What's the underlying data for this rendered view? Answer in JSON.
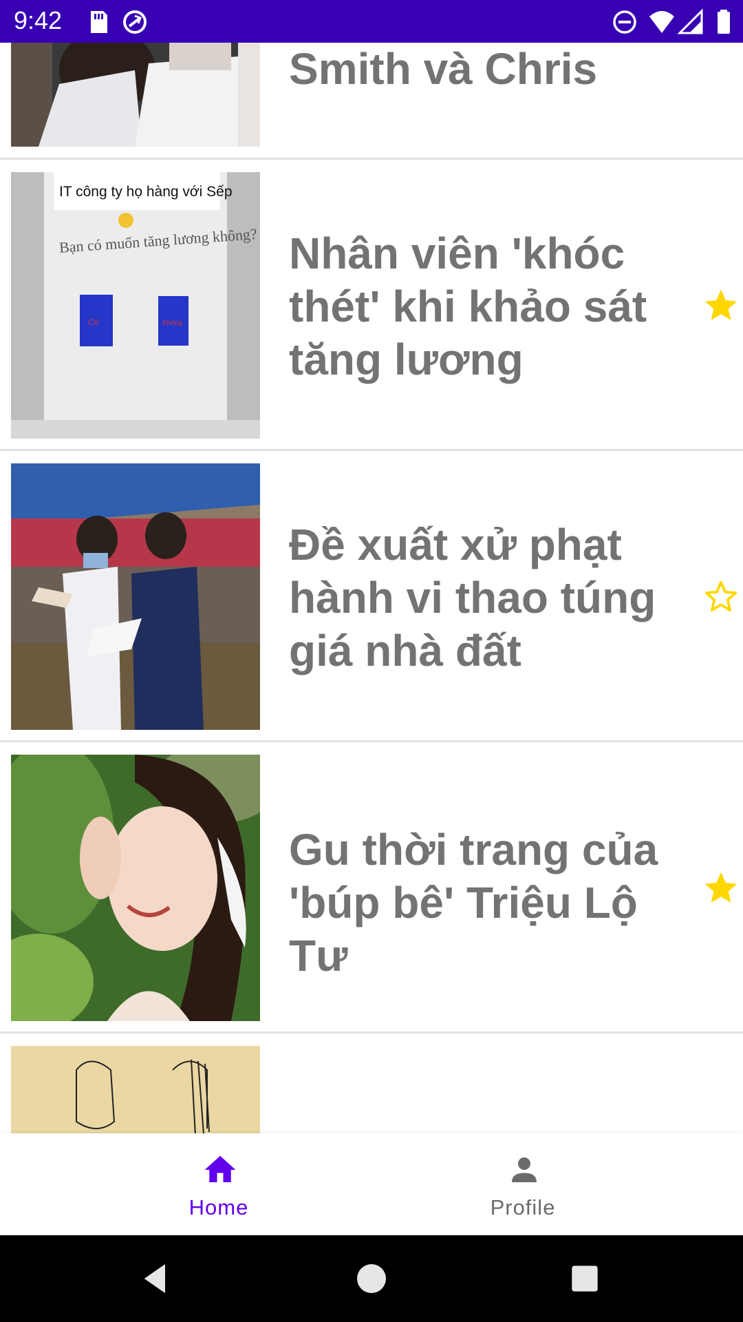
{
  "status_bar": {
    "time": "9:42",
    "background": "#3700b3",
    "left_icons": [
      "sd-card-icon",
      "sync-icon"
    ],
    "right_icons": [
      "do-not-disturb-icon",
      "wifi-icon",
      "signal-icon",
      "battery-icon"
    ]
  },
  "feed": {
    "items": [
      {
        "title": "Smith và Chris Rock",
        "favorite": null,
        "thumbnail": "partial photo of two people"
      },
      {
        "title": "Nhân viên 'khóc thét' khi khảo sát tăng lương",
        "favorite": true,
        "thumbnail_text": [
          "IT công ty họ hàng với Sếp",
          "Bạn có muốn tăng lương không?",
          "Có",
          "Không"
        ]
      },
      {
        "title": "Đề xuất xử phạt hành vi thao túng giá nhà đất",
        "favorite": false
      },
      {
        "title": "Gu thời trang của 'búp bê' Triệu Lộ Tư",
        "favorite": true
      },
      {
        "title": "",
        "favorite": null,
        "thumbnail": "partial drawing of two faces"
      }
    ]
  },
  "bottom_nav": {
    "items": [
      {
        "label": "Home",
        "icon": "home-icon",
        "selected": true
      },
      {
        "label": "Profile",
        "icon": "person-icon",
        "selected": false
      }
    ]
  },
  "system_nav": {
    "buttons": [
      "back-icon",
      "home-circle-icon",
      "recents-icon"
    ]
  },
  "colors": {
    "accent": "#6200ee",
    "star": "#ffd700",
    "title_text": "#737373"
  }
}
